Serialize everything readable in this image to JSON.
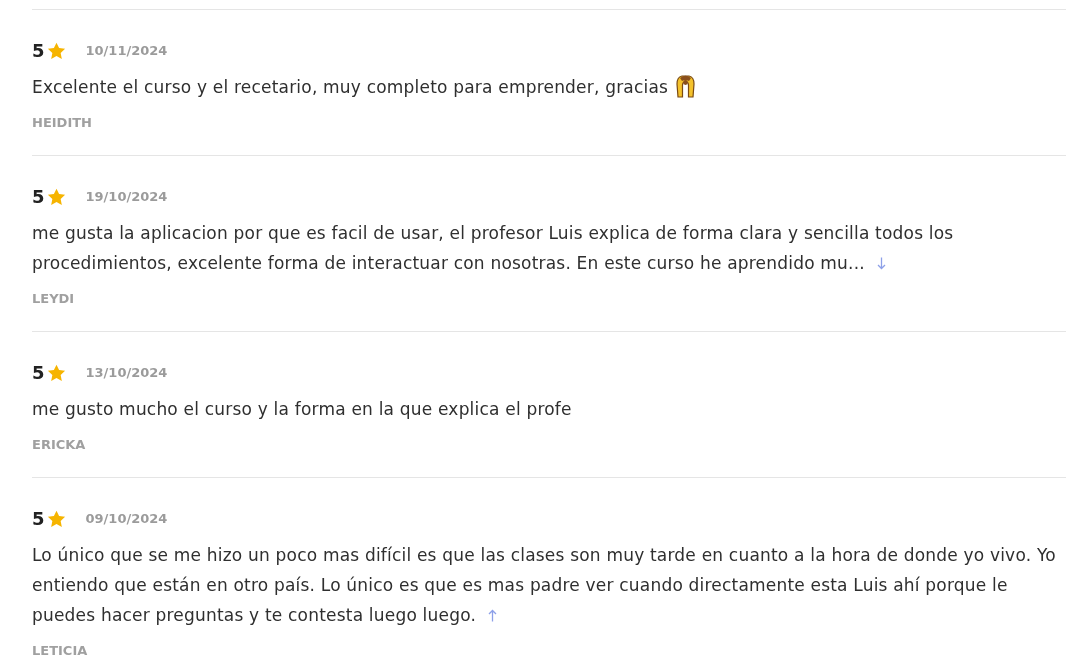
{
  "reviews": [
    {
      "rating": "5",
      "date": "10/11/2024",
      "text": "Excelente el curso y el recetario, muy completo para emprender, gracias",
      "emoji": true,
      "author": "HEIDITH"
    },
    {
      "rating": "5",
      "date": "19/10/2024",
      "text": "me gusta la aplicacion por que es facil de usar, el profesor Luis explica de forma clara y sencilla todos los procedimientos, excelente forma de interactuar con nosotras. En este curso he aprendido mu...",
      "toggle": {
        "expanded": false
      },
      "author": "LEYDI"
    },
    {
      "rating": "5",
      "date": "13/10/2024",
      "text": "me gusto mucho el curso y la forma en la que explica el profe",
      "author": "ERICKA"
    },
    {
      "rating": "5",
      "date": "09/10/2024",
      "text": "Lo único que se me hizo un poco mas difícil es que las clases son muy tarde en cuanto a la hora de donde yo vivo. Yo entiendo que están en otro país. Lo único es que es mas padre ver cuando directamente esta Luis ahí porque le puedes hacer preguntas y te contesta luego luego.",
      "toggle": {
        "expanded": true
      },
      "author": "LETICIA"
    }
  ]
}
